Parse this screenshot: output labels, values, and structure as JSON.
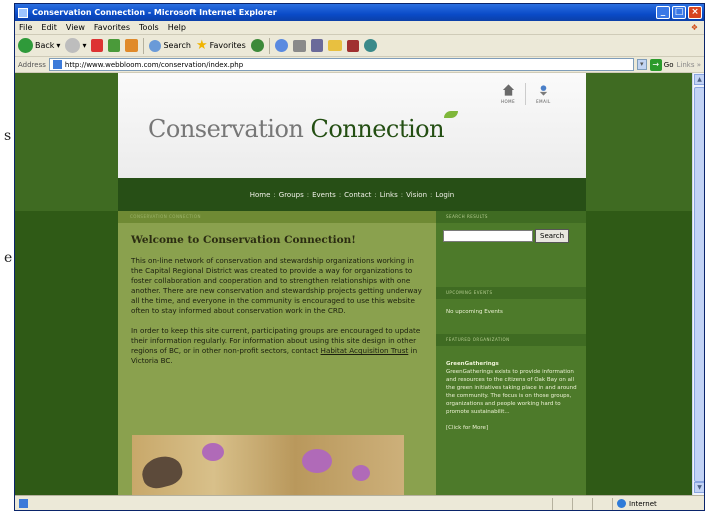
{
  "window": {
    "title": "Conservation Connection - Microsoft Internet Explorer",
    "controls": [
      "_",
      "□",
      "×"
    ]
  },
  "left_fragment": [
    "s",
    "e"
  ],
  "menu": [
    "File",
    "Edit",
    "View",
    "Favorites",
    "Tools",
    "Help"
  ],
  "toolbar": {
    "back_label": "Back",
    "search_label": "Search",
    "favorites_label": "Favorites"
  },
  "address": {
    "label": "Address",
    "url": "http://www.webbloom.com/conservation/index.php",
    "go_label": "Go",
    "links_label": "Links »"
  },
  "site": {
    "logo_part1": "Conservation ",
    "logo_part2": "Connection",
    "header_icons": [
      "HOME",
      "EMAIL"
    ],
    "nav": [
      "Home",
      "Groups",
      "Events",
      "Contact",
      "Links",
      "Vision",
      "Login"
    ],
    "nav_separator": ":",
    "main_header": "CONSERVATION CONNECTION",
    "welcome_title": "Welcome to Conservation Connection!",
    "para1": "This on-line network of conservation and stewardship organizations working in the Capital Regional District was created to provide a way for organizations to foster collaboration and cooperation and to strengthen relationships with one another. There are new conservation and stewardship projects getting underway all the time, and everyone in the community is encouraged to use this website often to stay informed about conservation work in the CRD.",
    "para2_before_link": "In order to keep this site current, participating groups are encouraged to update their information regularly. For information about using this site design in other regions of BC, or in other non-profit sectors, contact ",
    "para2_link": "Habitat Acquisition Trust",
    "para2_after_link": " in Victoria BC.",
    "search_header": "SEARCH RESULTS",
    "search_button": "Search",
    "upcoming_header": "UPCOMING EVENTS",
    "upcoming_text": "No upcoming Events",
    "featured_header": "FEATURED ORGANIZATION",
    "featured_org": "GreenGatherings",
    "featured_text": "GreenGatherings exists to provide information and resources to the citizens of Oak Bay on all the green initiatives taking place in and around the community. The focus is on those groups, organizations and people working hard to promote sustainabilit...",
    "click_more": "[Click for More]"
  },
  "status": {
    "zone": "Internet"
  }
}
